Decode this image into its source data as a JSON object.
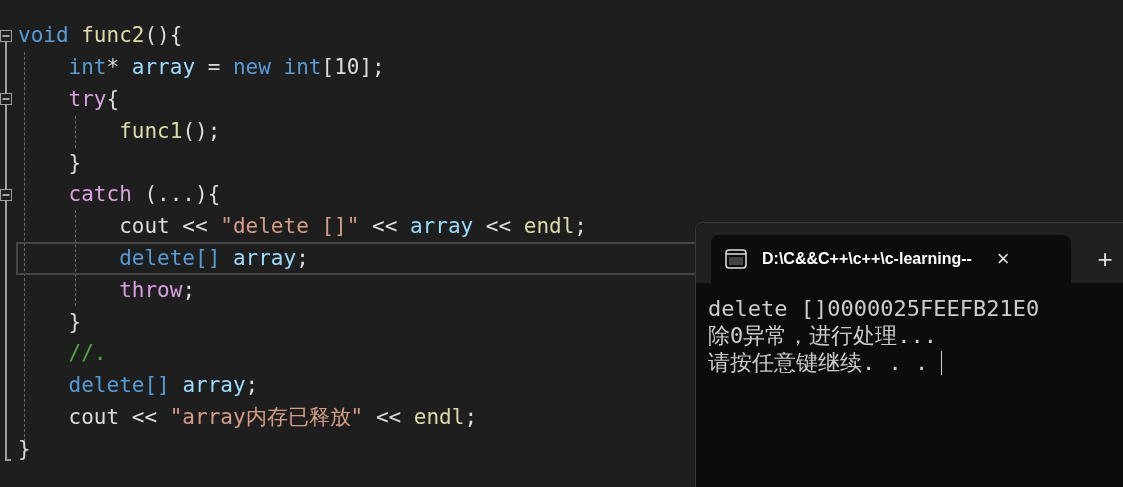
{
  "editor": {
    "lines": [
      {
        "expanded": true,
        "current": false,
        "tokens": [
          {
            "kind": "keyword",
            "text": "void "
          },
          {
            "kind": "function",
            "text": "func2"
          },
          {
            "kind": "plain",
            "text": "(){"
          }
        ]
      },
      {
        "current": false,
        "tokens": [
          {
            "kind": "keyword",
            "text": "    int"
          },
          {
            "kind": "plain",
            "text": "* "
          },
          {
            "kind": "variable",
            "text": "array"
          },
          {
            "kind": "plain",
            "text": " = "
          },
          {
            "kind": "keyword",
            "text": "new int"
          },
          {
            "kind": "plain",
            "text": "[10];"
          }
        ]
      },
      {
        "expanded": true,
        "current": false,
        "tokens": [
          {
            "kind": "control",
            "text": "    try"
          },
          {
            "kind": "plain",
            "text": "{"
          }
        ]
      },
      {
        "current": false,
        "tokens": [
          {
            "kind": "function",
            "text": "        func1"
          },
          {
            "kind": "plain",
            "text": "();"
          }
        ]
      },
      {
        "current": false,
        "tokens": [
          {
            "kind": "plain",
            "text": "    }"
          }
        ]
      },
      {
        "expanded": true,
        "current": false,
        "tokens": [
          {
            "kind": "control",
            "text": "    catch"
          },
          {
            "kind": "plain",
            "text": " (...){"
          }
        ]
      },
      {
        "current": false,
        "tokens": [
          {
            "kind": "plain",
            "text": "        cout << "
          },
          {
            "kind": "string",
            "text": "\"delete []\""
          },
          {
            "kind": "plain",
            "text": " << "
          },
          {
            "kind": "variable",
            "text": "array"
          },
          {
            "kind": "plain",
            "text": " << "
          },
          {
            "kind": "function",
            "text": "endl"
          },
          {
            "kind": "plain",
            "text": ";"
          }
        ]
      },
      {
        "current": true,
        "tokens": [
          {
            "kind": "keyword",
            "text": "        delete[] "
          },
          {
            "kind": "variable",
            "text": "array"
          },
          {
            "kind": "plain",
            "text": ";"
          }
        ]
      },
      {
        "current": false,
        "tokens": [
          {
            "kind": "control",
            "text": "        throw"
          },
          {
            "kind": "plain",
            "text": ";"
          }
        ]
      },
      {
        "current": false,
        "tokens": [
          {
            "kind": "plain",
            "text": "    }"
          }
        ]
      },
      {
        "current": false,
        "tokens": [
          {
            "kind": "comment",
            "text": "    //."
          }
        ]
      },
      {
        "current": false,
        "tokens": [
          {
            "kind": "keyword",
            "text": "    delete[] "
          },
          {
            "kind": "variable",
            "text": "array"
          },
          {
            "kind": "plain",
            "text": ";"
          }
        ]
      },
      {
        "current": false,
        "tokens": [
          {
            "kind": "plain",
            "text": "    cout << "
          },
          {
            "kind": "string",
            "text": "\"array内存已释放\""
          },
          {
            "kind": "plain",
            "text": " << "
          },
          {
            "kind": "function",
            "text": "endl"
          },
          {
            "kind": "plain",
            "text": ";"
          }
        ]
      },
      {
        "current": false,
        "tokens": [
          {
            "kind": "plain",
            "text": "}"
          }
        ]
      }
    ]
  },
  "terminal": {
    "tab": {
      "title": "D:\\C&&C++\\c++\\c-learning--",
      "close": "×",
      "selected": true
    },
    "new_tab": "+",
    "output": [
      "delete []0000025FEEFB21E0",
      "除0异常，进行处理...",
      "请按任意键继续. . . "
    ],
    "cursor": true
  }
}
